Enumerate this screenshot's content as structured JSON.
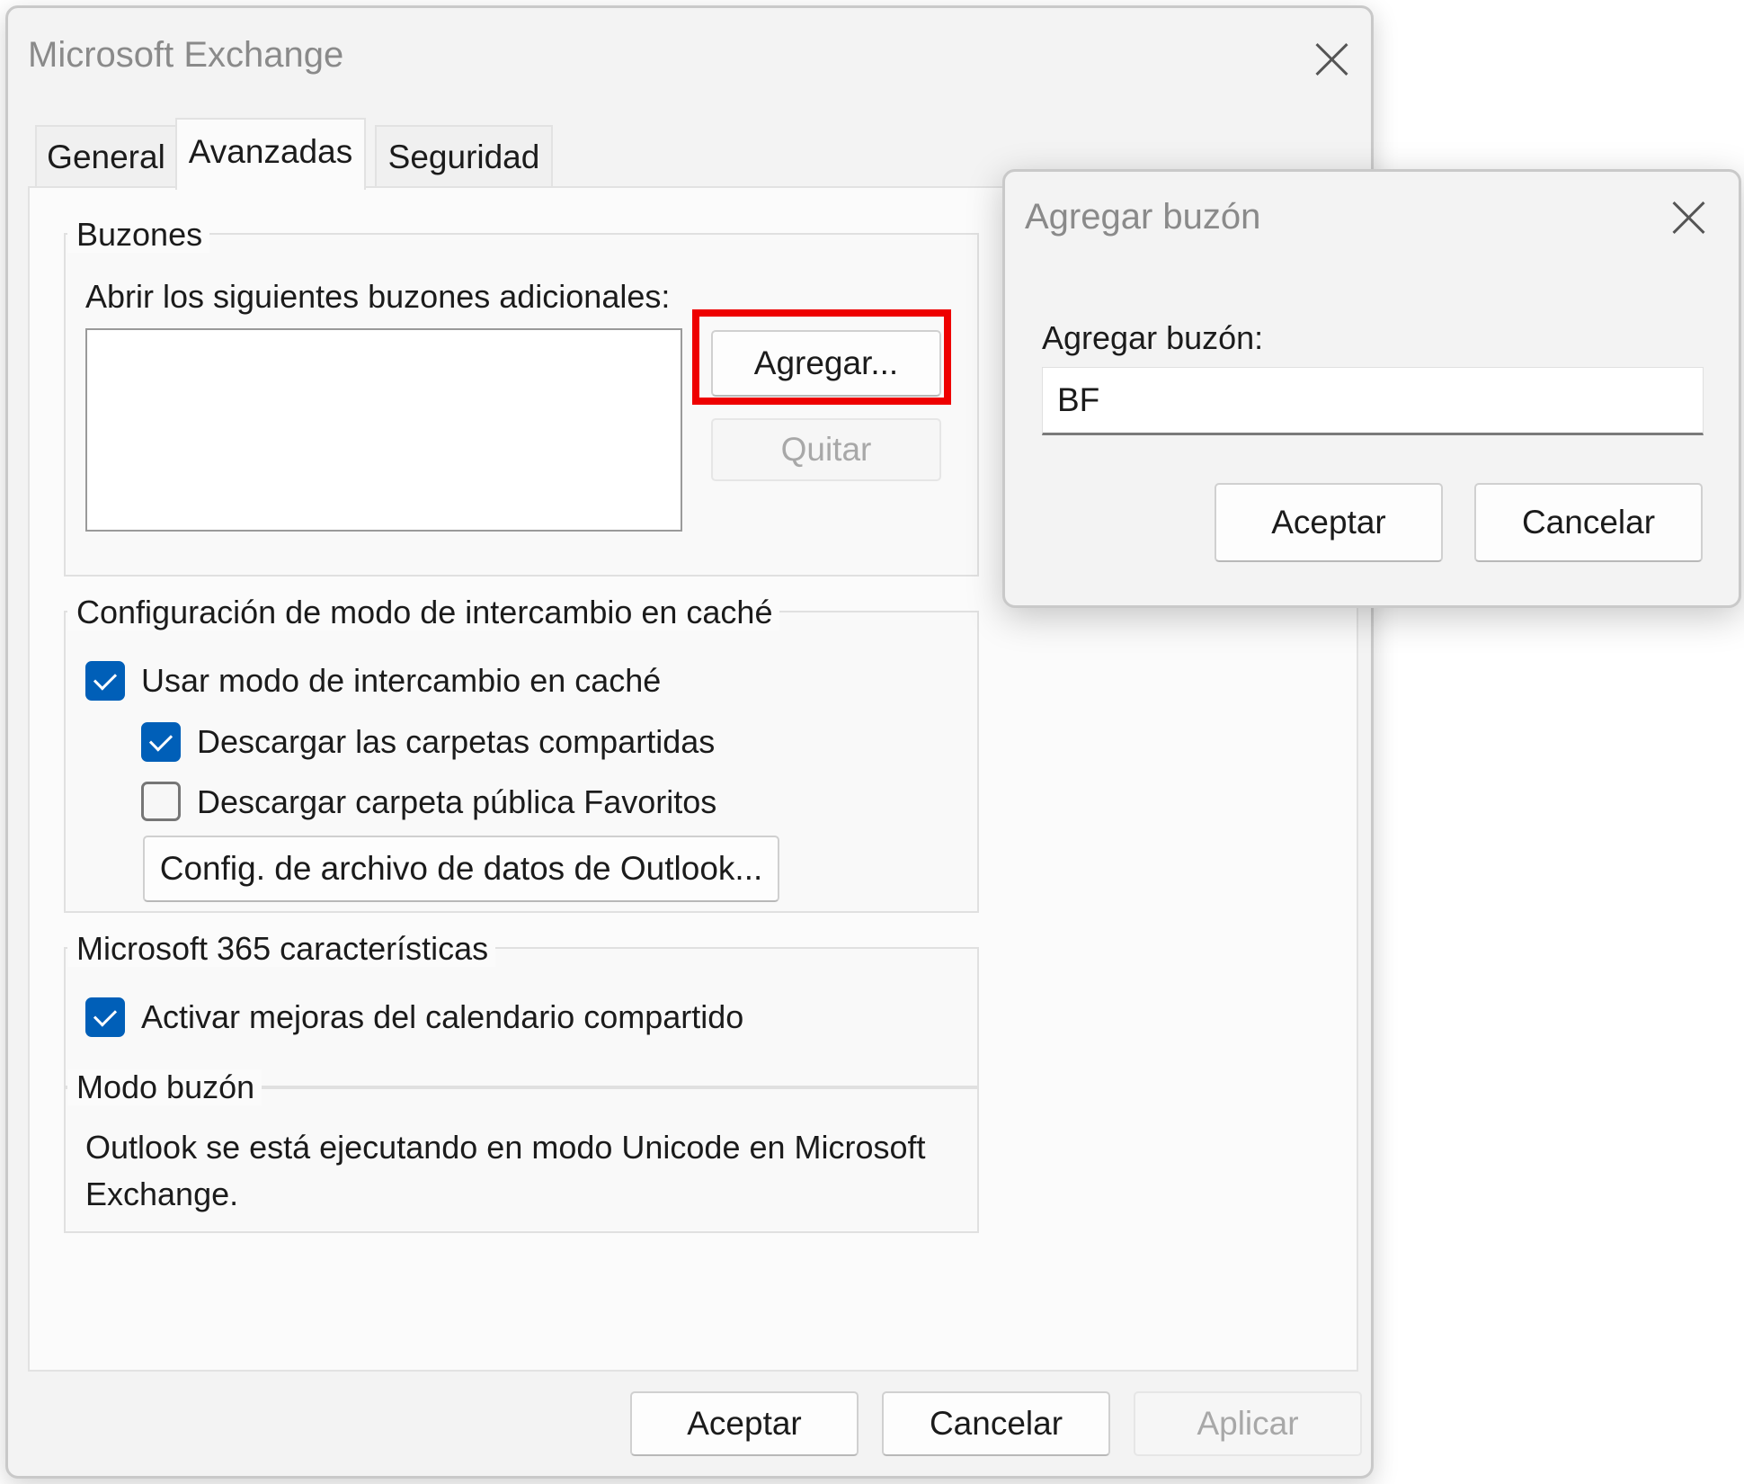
{
  "main_dialog": {
    "title": "Microsoft Exchange",
    "tabs": [
      {
        "label": "General"
      },
      {
        "label": "Avanzadas",
        "active": true
      },
      {
        "label": "Seguridad"
      }
    ],
    "buzones": {
      "legend": "Buzones",
      "open_label": "Abrir los siguientes buzones adicionales:",
      "add_button": "Agregar...",
      "remove_button": "Quitar"
    },
    "cached_mode": {
      "legend": "Configuración de modo de intercambio en caché",
      "use_cached": {
        "label": "Usar modo de intercambio en caché",
        "checked": true
      },
      "download_shared": {
        "label": "Descargar las carpetas compartidas",
        "checked": true
      },
      "download_public": {
        "label": "Descargar carpeta pública Favoritos",
        "checked": false
      },
      "ost_button": "Config. de archivo de datos de Outlook..."
    },
    "m365": {
      "legend": "Microsoft 365 características",
      "shared_calendar": {
        "label": "Activar mejoras del calendario compartido",
        "checked": true
      }
    },
    "mailbox_mode": {
      "legend": "Modo buzón",
      "text_line1": "Outlook se está ejecutando en modo Unicode en Microsoft",
      "text_line2": "Exchange."
    },
    "footer": {
      "ok": "Aceptar",
      "cancel": "Cancelar",
      "apply": "Aplicar"
    }
  },
  "add_mailbox_dialog": {
    "title": "Agregar buzón",
    "field_label": "Agregar buzón:",
    "field_value": "BF",
    "ok": "Aceptar",
    "cancel": "Cancelar"
  },
  "colors": {
    "accent": "#005fb8",
    "highlight": "#ee0000"
  }
}
